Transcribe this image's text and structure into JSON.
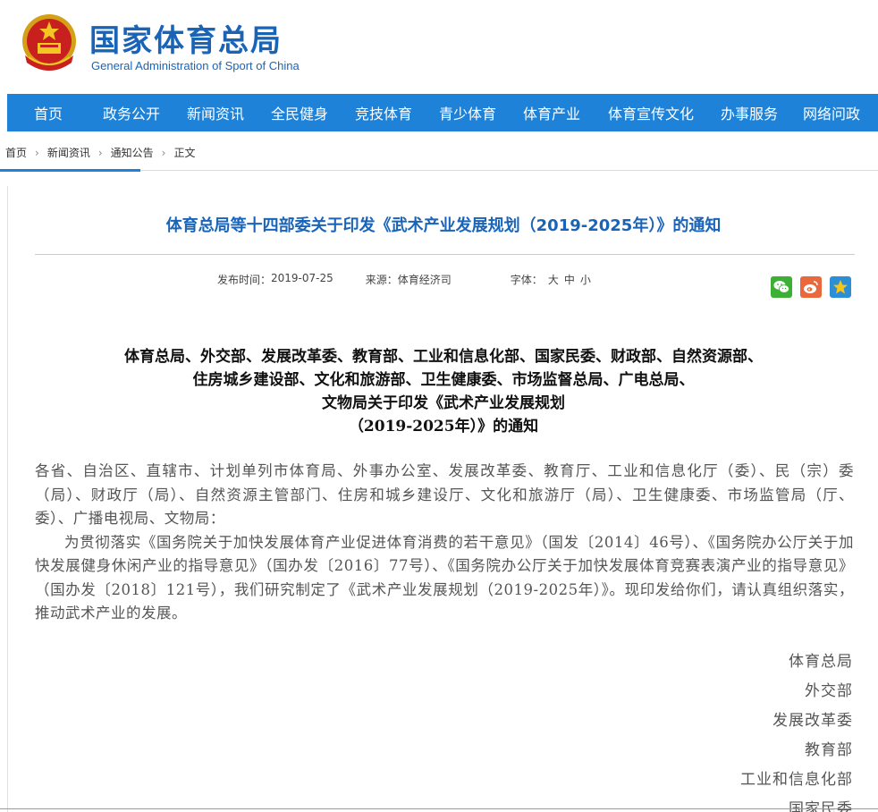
{
  "header": {
    "title": "国家体育总局",
    "subtitle": "General Administration of Sport of China"
  },
  "nav": {
    "items": [
      "首页",
      "政务公开",
      "新闻资讯",
      "全民健身",
      "竞技体育",
      "青少体育",
      "体育产业",
      "体育宣传文化",
      "办事服务",
      "网络问政"
    ]
  },
  "breadcrumb": {
    "items": [
      "首页",
      "新闻资讯",
      "通知公告",
      "正文"
    ]
  },
  "article": {
    "title": "体育总局等十四部委关于印发《武术产业发展规划（2019-2025年）》的通知",
    "meta": {
      "date_label": "发布时间：",
      "date": "2019-07-25",
      "source_label": "来源：",
      "source": "体育经济司",
      "font_label": "字体：",
      "font_large": "大",
      "font_medium": "中",
      "font_small": "小"
    },
    "share_icons": [
      "wechat-icon",
      "weibo-icon",
      "favorite-icon"
    ],
    "heading_lines": [
      "体育总局、外交部、发展改革委、教育部、工业和信息化部、国家民委、财政部、自然资源部、",
      "住房城乡建设部、文化和旅游部、卫生健康委、市场监督总局、广电总局、",
      "文物局关于印发《武术产业发展规划",
      "（2019-2025年）》的通知"
    ],
    "salutation": "各省、自治区、直辖市、计划单列市体育局、外事办公室、发展改革委、教育厅、工业和信息化厅（委）、民（宗）委（局）、财政厅（局）、自然资源主管部门、住房和城乡建设厅、文化和旅游厅（局）、卫生健康委、市场监管局（厅、委）、广播电视局、文物局：",
    "paragraph": "为贯彻落实《国务院关于加快发展体育产业促进体育消费的若干意见》（国发〔2014〕46号）、《国务院办公厅关于加快发展健身休闲产业的指导意见》（国办发〔2016〕77号）、《国务院办公厅关于加快发展体育竞赛表演产业的指导意见》（国办发〔2018〕121号），我们研究制定了《武术产业发展规划（2019-2025年）》。现印发给你们，请认真组织落实，推动武术产业的发展。",
    "signers": [
      "体育总局",
      "外交部",
      "发展改革委",
      "教育部",
      "工业和信息化部",
      "国家民委"
    ]
  },
  "colors": {
    "brand_blue": "#1a64b8",
    "nav_blue": "#1e82d8"
  }
}
